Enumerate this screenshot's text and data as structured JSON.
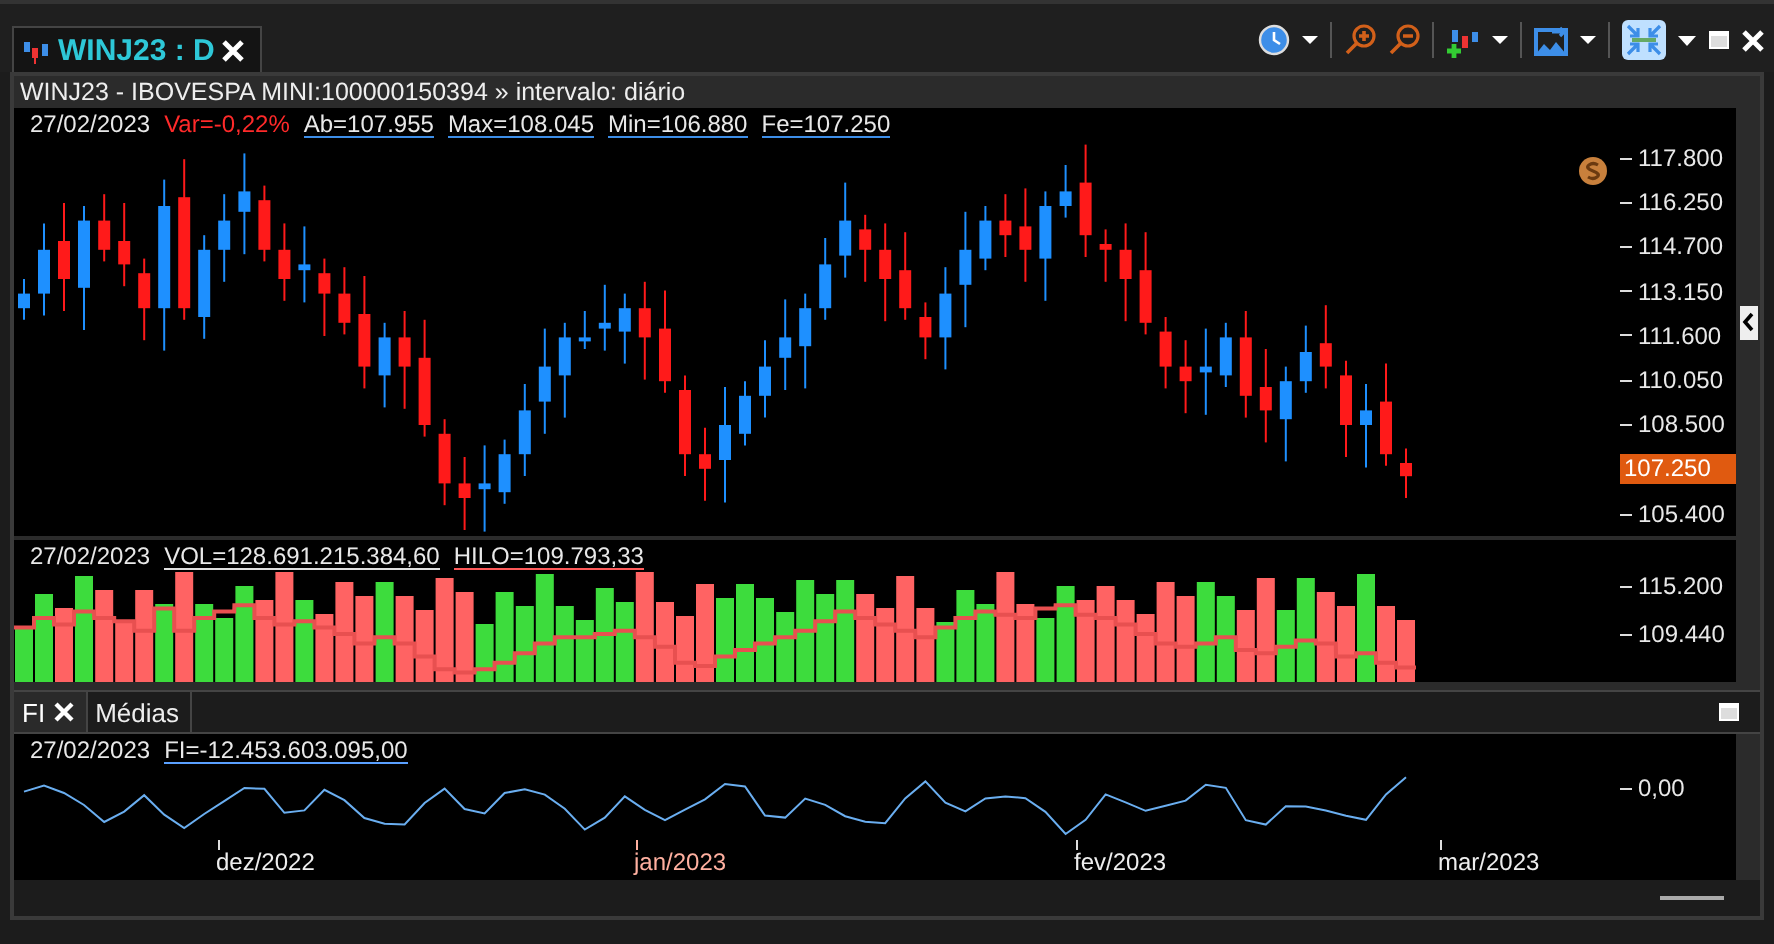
{
  "tab": {
    "label": "WINJ23 : D",
    "selected": true
  },
  "chart_title": "WINJ23 - IBOVESPA MINI:100000150394 » intervalo: diário",
  "price_panel": {
    "date": "27/02/2023",
    "readings": [
      {
        "kind": "var",
        "text": "Var=-0,22%"
      },
      {
        "kind": "link",
        "text": "Ab=107.955",
        "color": "#3d8ee8"
      },
      {
        "kind": "link",
        "text": "Max=108.045",
        "color": "#3d8ee8"
      },
      {
        "kind": "link",
        "text": "Min=106.880",
        "color": "#3d8ee8"
      },
      {
        "kind": "link",
        "text": "Fe=107.250",
        "color": "#3d8ee8"
      }
    ],
    "y_ticks": [
      "117.800",
      "116.250",
      "114.700",
      "113.150",
      "111.600",
      "110.050",
      "108.500",
      "105.400"
    ],
    "last_price": "107.250"
  },
  "volume_panel": {
    "date": "27/02/2023",
    "readings": [
      {
        "kind": "link",
        "text": "VOL=128.691.215.384,60",
        "color": "#e0e0e0"
      },
      {
        "kind": "link",
        "text": "HILO=109.793,33",
        "color": "#ff5a5a"
      }
    ],
    "y_ticks": [
      "115.200",
      "109.440"
    ]
  },
  "indicator_tabs": [
    {
      "label": "FI",
      "closable": true,
      "selected": true
    },
    {
      "label": "Médias",
      "closable": false,
      "selected": false
    }
  ],
  "fi_panel": {
    "date": "27/02/2023",
    "readings": [
      {
        "kind": "link",
        "text": "FI=-12.453.603.095,00",
        "color": "#5aa0ff"
      }
    ],
    "y_ticks": [
      "0,00"
    ]
  },
  "x_axis": [
    {
      "label": "dez/2022",
      "year_start": false
    },
    {
      "label": "jan/2023",
      "year_start": true
    },
    {
      "label": "fev/2023",
      "year_start": false
    },
    {
      "label": "mar/2023",
      "year_start": false
    }
  ]
}
